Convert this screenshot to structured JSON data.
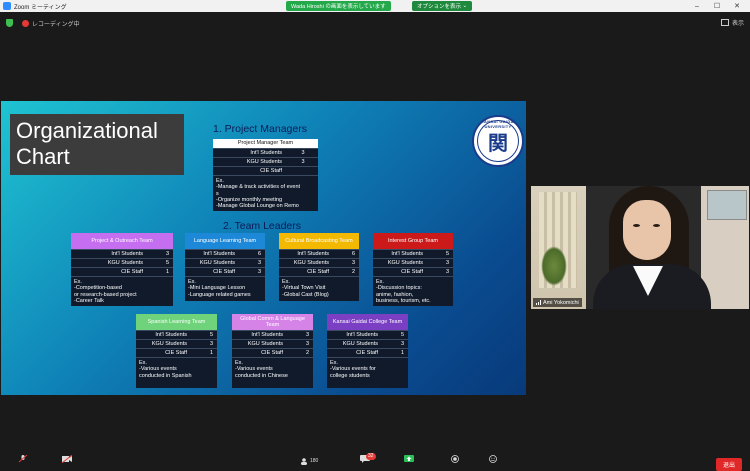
{
  "window": {
    "title": "Zoom ミーティング",
    "share_banner": "Wada Hiroshi の画面を表示しています",
    "options_label": "オプションを表示",
    "controls": [
      "–",
      "☐",
      "✕"
    ]
  },
  "status": {
    "recording_label": "レコーディング中",
    "view_label": "表示"
  },
  "slide": {
    "title_line1": "Organizational",
    "title_line2": "Chart",
    "section1": "1. Project Managers",
    "section2": "2. Team Leaders",
    "logo_text": "KANSAI GAIDAI UNIVERSITY",
    "logo_glyph": "関",
    "project_manager": {
      "header": "Project Manager Team",
      "rows": [
        {
          "label": "Int'l Students",
          "value": "3"
        },
        {
          "label": "KGU Students",
          "value": "3"
        },
        {
          "label": "CIE Staff",
          "value": ""
        }
      ],
      "example": "Ex.\n-Manage & track activities of event\ns\n-Organize monthly meeting\n-Manage Global Lounge on Remo"
    },
    "teams": [
      {
        "name": "Project &\nOutreach Team",
        "color": "#c56ef0",
        "rows": [
          {
            "label": "Int'l Students",
            "value": "3"
          },
          {
            "label": "KGU Students",
            "value": "5"
          },
          {
            "label": "CIE Staff",
            "value": "1"
          }
        ],
        "example": "Ex.\n-Competition-based\n or research-based project\n-Career Talk"
      },
      {
        "name": "Language Learning\nTeam",
        "color": "#1e88d8",
        "rows": [
          {
            "label": "Int'l Students",
            "value": "6"
          },
          {
            "label": "KGU Students",
            "value": "3"
          },
          {
            "label": "CIE Staff",
            "value": "3"
          }
        ],
        "example": "Ex.\n-Mini Language Lesson\n-Language related games"
      },
      {
        "name": "Cultural Broadcasting\nTeam",
        "color": "#f2b900",
        "rows": [
          {
            "label": "Int'l Students",
            "value": "6"
          },
          {
            "label": "KGU Students",
            "value": "3"
          },
          {
            "label": "CIE Staff",
            "value": "2"
          }
        ],
        "example": "Ex.\n-Virtual Town Visit\n-Global Cast (Blog)"
      },
      {
        "name": "Interest Group\nTeam",
        "color": "#cc1a1a",
        "rows": [
          {
            "label": "Int'l Students",
            "value": "5"
          },
          {
            "label": "KGU Students",
            "value": "3"
          },
          {
            "label": "CIE Staff",
            "value": "3"
          }
        ],
        "example": "Ex.\n-Discussion topics:\n anime, fashion,\n business, tourism, etc."
      },
      {
        "name": "Spanish Learning\nTeam",
        "color": "#6ed37a",
        "rows": [
          {
            "label": "Int'l Students",
            "value": "5"
          },
          {
            "label": "KGU Students",
            "value": "3"
          },
          {
            "label": "CIE Staff",
            "value": "1"
          }
        ],
        "example": "Ex.\n-Various events\n conducted in Spanish"
      },
      {
        "name": "Global Comm &\nLanguage Team",
        "color": "#d683e8",
        "rows": [
          {
            "label": "Int'l Students",
            "value": "3"
          },
          {
            "label": "KGU Students",
            "value": "3"
          },
          {
            "label": "CIE Staff",
            "value": "2"
          }
        ],
        "example": "Ex.\n-Various events\n conducted in Chinese"
      },
      {
        "name": "Kansai Gaidai College\nTeam",
        "color": "#7b3fc4",
        "rows": [
          {
            "label": "Int'l Students",
            "value": "5"
          },
          {
            "label": "KGU Students",
            "value": "3"
          },
          {
            "label": "CIE Staff",
            "value": "1"
          }
        ],
        "example": "Ex.\n-Various events for\n college students"
      }
    ]
  },
  "video": {
    "participant_name": "Ami Yokomichi"
  },
  "toolbar": {
    "participants_count": "180",
    "chat_badge": "32",
    "end_label": "退出"
  }
}
